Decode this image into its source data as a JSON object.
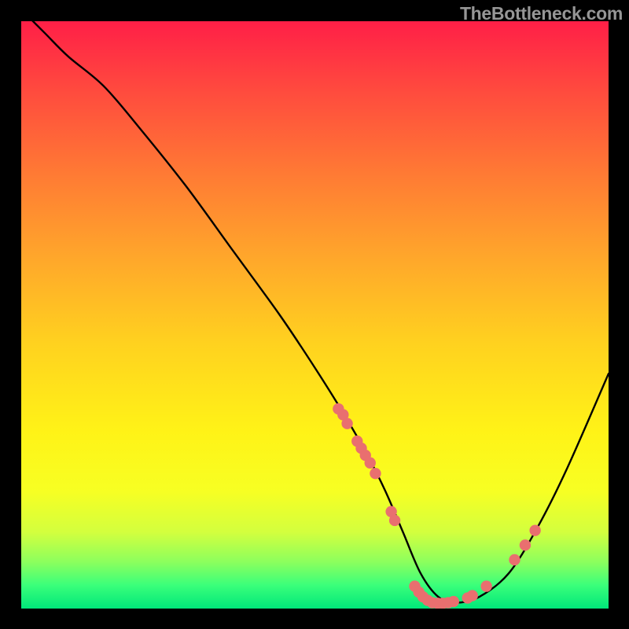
{
  "watermark": "TheBottleneck.com",
  "chart_data": {
    "type": "line",
    "title": "",
    "xlabel": "",
    "ylabel": "",
    "xlim": [
      0,
      100
    ],
    "ylim": [
      0,
      100
    ],
    "curve": {
      "description": "bottleneck curve, y = 100 at left descending to minimum near x≈70 then rising toward right",
      "x": [
        0,
        4,
        8,
        14,
        20,
        28,
        36,
        44,
        50,
        55,
        59,
        62,
        65,
        68,
        71,
        74,
        78,
        83,
        88,
        93,
        100
      ],
      "y": [
        102,
        98,
        94,
        89,
        82,
        72,
        61,
        50,
        41,
        33,
        26,
        20,
        13,
        6,
        2,
        1,
        2,
        6,
        14,
        24,
        40
      ]
    },
    "highlight_points": {
      "description": "salmon dots along curve near trough",
      "color": "#e96f6f",
      "points": [
        {
          "x": 54.0,
          "y": 34.0
        },
        {
          "x": 54.8,
          "y": 33.0
        },
        {
          "x": 55.5,
          "y": 31.5
        },
        {
          "x": 57.2,
          "y": 28.5
        },
        {
          "x": 57.9,
          "y": 27.3
        },
        {
          "x": 58.6,
          "y": 26.1
        },
        {
          "x": 59.4,
          "y": 24.8
        },
        {
          "x": 60.3,
          "y": 23.0
        },
        {
          "x": 63.0,
          "y": 16.5
        },
        {
          "x": 63.6,
          "y": 15.0
        },
        {
          "x": 67.0,
          "y": 3.8
        },
        {
          "x": 67.7,
          "y": 2.8
        },
        {
          "x": 68.4,
          "y": 2.0
        },
        {
          "x": 69.2,
          "y": 1.4
        },
        {
          "x": 70.0,
          "y": 1.0
        },
        {
          "x": 70.9,
          "y": 0.9
        },
        {
          "x": 71.8,
          "y": 0.9
        },
        {
          "x": 72.7,
          "y": 1.0
        },
        {
          "x": 73.6,
          "y": 1.2
        },
        {
          "x": 76.0,
          "y": 1.8
        },
        {
          "x": 76.8,
          "y": 2.2
        },
        {
          "x": 79.2,
          "y": 3.8
        },
        {
          "x": 84.0,
          "y": 8.3
        },
        {
          "x": 85.8,
          "y": 10.8
        },
        {
          "x": 87.5,
          "y": 13.3
        }
      ]
    },
    "background_gradient": {
      "top": "#ff1f47",
      "bottom": "#00e77a"
    }
  }
}
